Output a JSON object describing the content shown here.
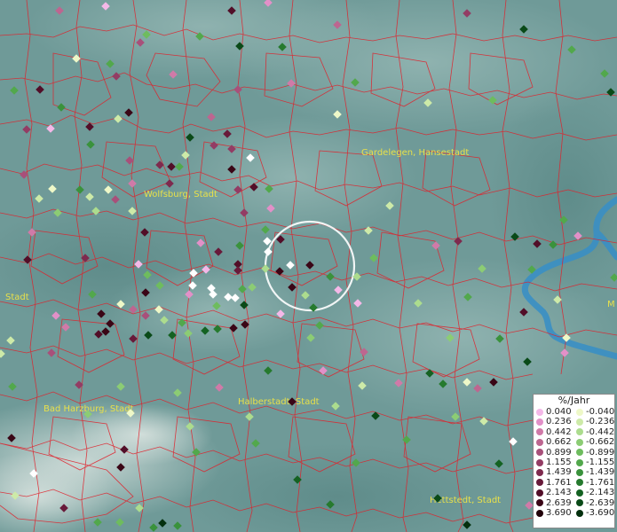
{
  "places": [
    {
      "name": "Gardelegen, Hansestadt"
    },
    {
      "name": "Wolfsburg, Stadt"
    },
    {
      "name": "Stadt"
    },
    {
      "name": "Bad Harzburg, Stadt"
    },
    {
      "name": "Halberstadt, Stadt"
    },
    {
      "name": "Hettstedt, Stadt"
    },
    {
      "name": "M"
    }
  ],
  "legend": {
    "title": "%/Jahr",
    "positive": [
      {
        "label": "0.040",
        "color": "#f4b8e8"
      },
      {
        "label": "0.236",
        "color": "#e290c8"
      },
      {
        "label": "0.442",
        "color": "#d07aa8"
      },
      {
        "label": "0.662",
        "color": "#bd6690"
      },
      {
        "label": "0.899",
        "color": "#a8507a"
      },
      {
        "label": "1.155",
        "color": "#933c64"
      },
      {
        "label": "1.439",
        "color": "#7e2a4e"
      },
      {
        "label": "1.761",
        "color": "#681a3a"
      },
      {
        "label": "2.143",
        "color": "#520e28"
      },
      {
        "label": "2.639",
        "color": "#3a0616"
      },
      {
        "label": "3.690",
        "color": "#22020a"
      }
    ],
    "negative": [
      {
        "label": "-0.040",
        "color": "#eef8c8"
      },
      {
        "label": "-0.236",
        "color": "#cdeaa8"
      },
      {
        "label": "-0.442",
        "color": "#acdc8e"
      },
      {
        "label": "-0.662",
        "color": "#8ccc74"
      },
      {
        "label": "-0.899",
        "color": "#6ebc5e"
      },
      {
        "label": "-1.155",
        "color": "#52a84c"
      },
      {
        "label": "-1.439",
        "color": "#3a923c"
      },
      {
        "label": "-1.761",
        "color": "#267a2e"
      },
      {
        "label": "-2.143",
        "color": "#146222"
      },
      {
        "label": "-2.639",
        "color": "#0a4a18"
      },
      {
        "label": "-3.690",
        "color": "#04300e"
      }
    ]
  },
  "colors": {
    "background": "#6f9a98",
    "boundary": "#e0202a",
    "river": "#3a8fc4",
    "label": "#e8e04a",
    "highlight": "#ffffff"
  }
}
